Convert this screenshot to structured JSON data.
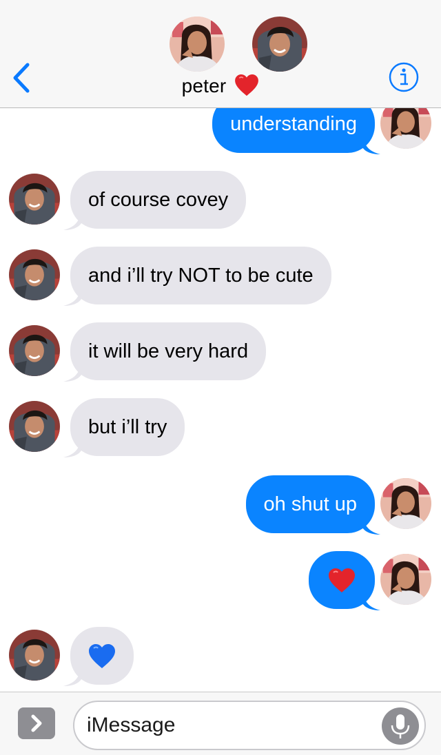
{
  "header": {
    "contact_name": "peter",
    "heart_emoji": "❤️"
  },
  "messages": [
    {
      "from": "me",
      "text": "understanding"
    },
    {
      "from": "peter",
      "text": "of course covey"
    },
    {
      "from": "peter",
      "text": "and i’ll try NOT to be cute"
    },
    {
      "from": "peter",
      "text": "it will be very hard"
    },
    {
      "from": "peter",
      "text": "but i’ll try"
    },
    {
      "from": "me",
      "text": "oh shut up"
    },
    {
      "from": "me",
      "emoji": "red-heart",
      "text": "❤️"
    },
    {
      "from": "peter",
      "emoji": "blue-heart",
      "text": "💙"
    }
  ],
  "input": {
    "placeholder": "iMessage"
  },
  "colors": {
    "outgoing_bubble": "#0a84ff",
    "incoming_bubble": "#e6e5eb",
    "accent": "#0a7aff"
  },
  "icons": [
    "back-chevron-icon",
    "info-icon",
    "apps-chevron-icon",
    "microphone-icon",
    "red-heart-icon",
    "blue-heart-icon"
  ]
}
